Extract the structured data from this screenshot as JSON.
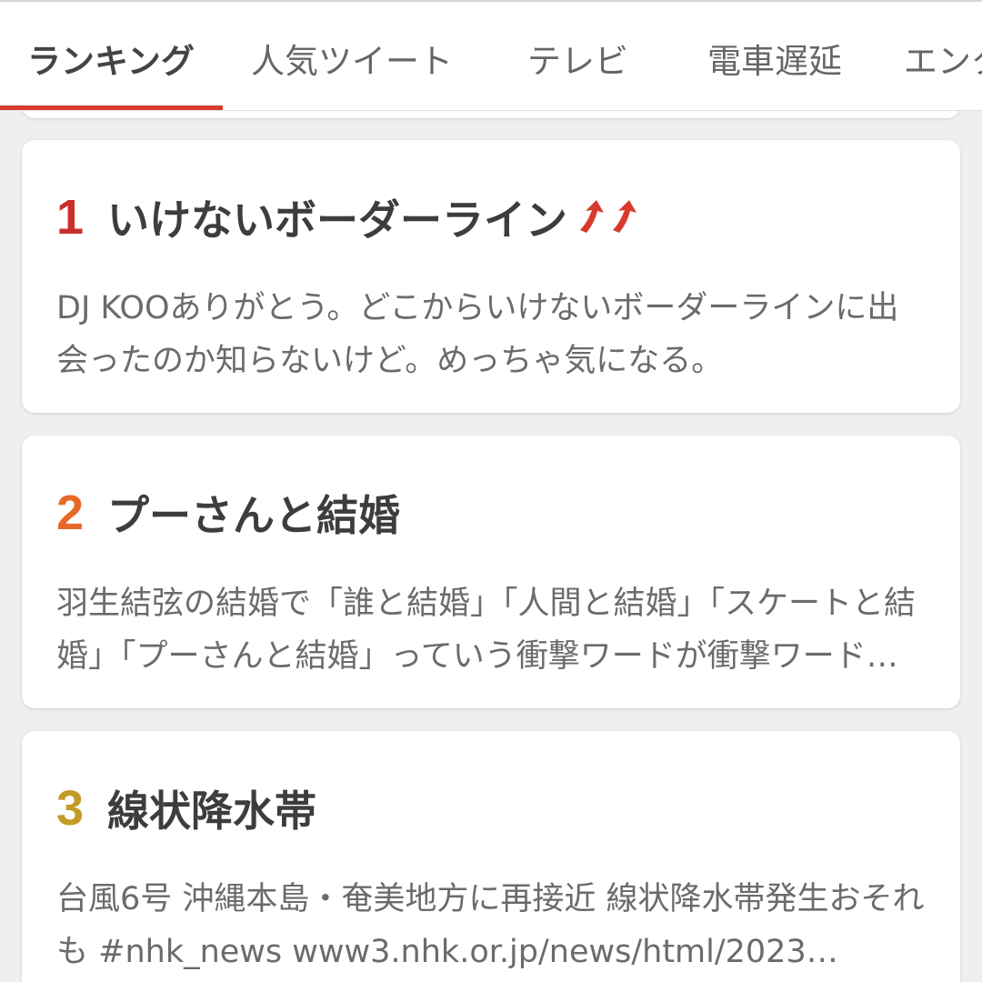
{
  "tabs": [
    {
      "label": "ランキング",
      "active": true
    },
    {
      "label": "人気ツイート",
      "active": false
    },
    {
      "label": "テレビ",
      "active": false
    },
    {
      "label": "電車遅延",
      "active": false
    },
    {
      "label": "エンタ",
      "active": false
    }
  ],
  "colors": {
    "accent": "#d83a2e",
    "rank1": "#c8302b",
    "rank2": "#e8682a",
    "rank3": "#c39a25",
    "trend_up": "#d83a2e"
  },
  "ranking": [
    {
      "rank": "1",
      "title": "いけないボーダーライン",
      "trend_icon": "double-up-arrow-icon",
      "description": "DJ KOOありがとう。どこからいけないボーダーラインに出会ったのか知らないけど。めっちゃ気になる。"
    },
    {
      "rank": "2",
      "title": "プーさんと結婚",
      "description": "羽生結弦の結婚で「誰と結婚」「人間と結婚」「スケートと結婚」「プーさんと結婚」っていう衝撃ワードが衝撃ワードが…"
    },
    {
      "rank": "3",
      "title": "線状降水帯",
      "description": "台風6号 沖縄本島・奄美地方に再接近 線状降水帯発生おそれも #nhk_news www3.nhk.or.jp/news/html/2023…"
    }
  ]
}
